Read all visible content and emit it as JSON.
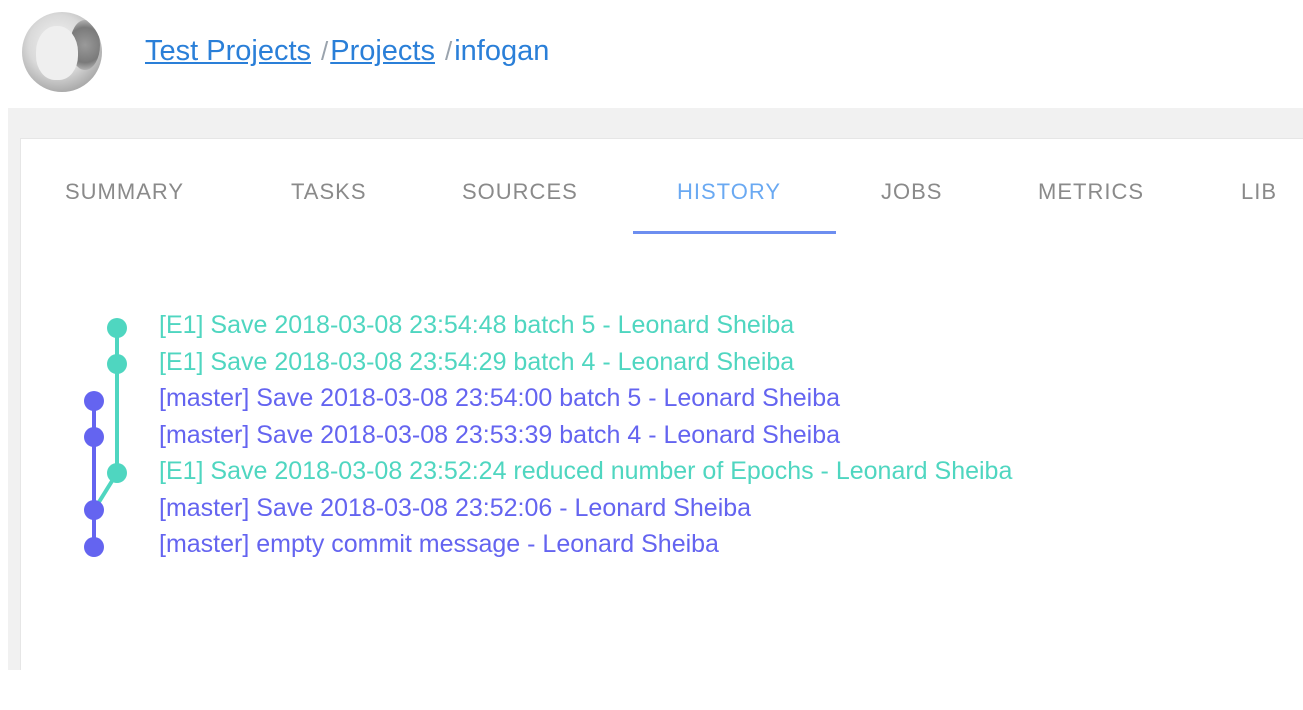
{
  "breadcrumb": {
    "items": [
      {
        "label": "Test Projects"
      },
      {
        "label": "Projects"
      }
    ],
    "separator": "/",
    "current": "infogan"
  },
  "tabs": [
    {
      "label": "SUMMARY",
      "active": false
    },
    {
      "label": "TASKS",
      "active": false
    },
    {
      "label": "SOURCES",
      "active": false
    },
    {
      "label": "HISTORY",
      "active": true
    },
    {
      "label": "JOBS",
      "active": false
    },
    {
      "label": "METRICS",
      "active": false
    },
    {
      "label": "LIB",
      "active": false
    }
  ],
  "colors": {
    "branch_e1": "#4fd6c0",
    "branch_master": "#6464f0",
    "link": "#2a7fd8",
    "tab_active": "#6aa9f2",
    "tab_inactive": "#8a8a8a"
  },
  "history": {
    "commits": [
      {
        "text": "[E1] Save 2018-03-08 23:54:48 batch 5 - Leonard Sheiba",
        "branch": "E1"
      },
      {
        "text": "[E1] Save 2018-03-08 23:54:29 batch 4 - Leonard Sheiba",
        "branch": "E1"
      },
      {
        "text": "[master] Save 2018-03-08 23:54:00 batch 5 - Leonard Sheiba",
        "branch": "master"
      },
      {
        "text": "[master] Save 2018-03-08 23:53:39 batch 4 - Leonard Sheiba",
        "branch": "master"
      },
      {
        "text": "[E1] Save 2018-03-08 23:52:24 reduced number of Epochs - Leonard Sheiba",
        "branch": "E1"
      },
      {
        "text": "[master] Save 2018-03-08 23:52:06 - Leonard Sheiba",
        "branch": "master"
      },
      {
        "text": "[master] empty commit message - Leonard Sheiba",
        "branch": "master"
      }
    ]
  }
}
